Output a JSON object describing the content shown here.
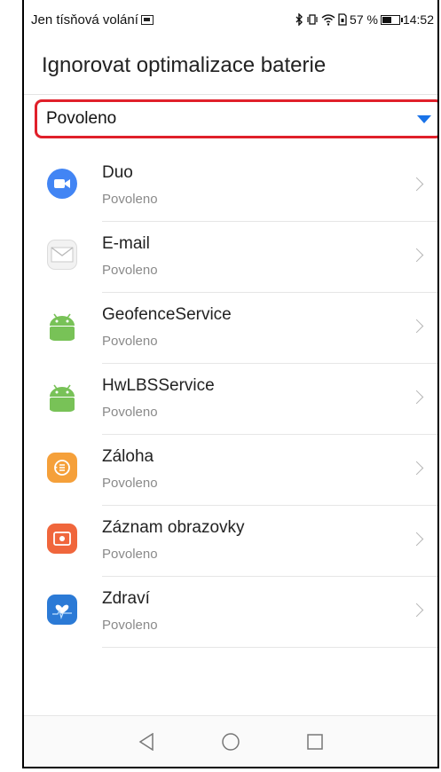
{
  "statusbar": {
    "carrier": "Jen tísňová volání",
    "battery_percent": "57 %",
    "time": "14:52",
    "icons": [
      "message-icon",
      "bluetooth-icon",
      "vibrate-icon",
      "wifi-icon",
      "sim-icon",
      "battery-icon"
    ],
    "battery_level": 0.57
  },
  "header": {
    "title": "Ignorovat optimalizace baterie"
  },
  "filter": {
    "selected": "Povoleno",
    "accent": "#1a73e8",
    "highlight": "#e0202a"
  },
  "apps": [
    {
      "name": "Duo",
      "status": "Povoleno",
      "icon": "duo-icon",
      "color": "#4285f4"
    },
    {
      "name": "E-mail",
      "status": "Povoleno",
      "icon": "email-icon",
      "color": "#f2f2f2"
    },
    {
      "name": "GeofenceService",
      "status": "Povoleno",
      "icon": "android-icon",
      "color": "#78c257"
    },
    {
      "name": "HwLBSService",
      "status": "Povoleno",
      "icon": "android-icon",
      "color": "#78c257"
    },
    {
      "name": "Záloha",
      "status": "Povoleno",
      "icon": "backup-icon",
      "color": "#f5a03a"
    },
    {
      "name": "Záznam obrazovky",
      "status": "Povoleno",
      "icon": "screen-recorder-icon",
      "color": "#f0663c"
    },
    {
      "name": "Zdraví",
      "status": "Povoleno",
      "icon": "health-icon",
      "color": "#2b7ad6"
    }
  ],
  "navbar": {
    "buttons": [
      "back-icon",
      "home-icon",
      "recents-icon"
    ]
  }
}
